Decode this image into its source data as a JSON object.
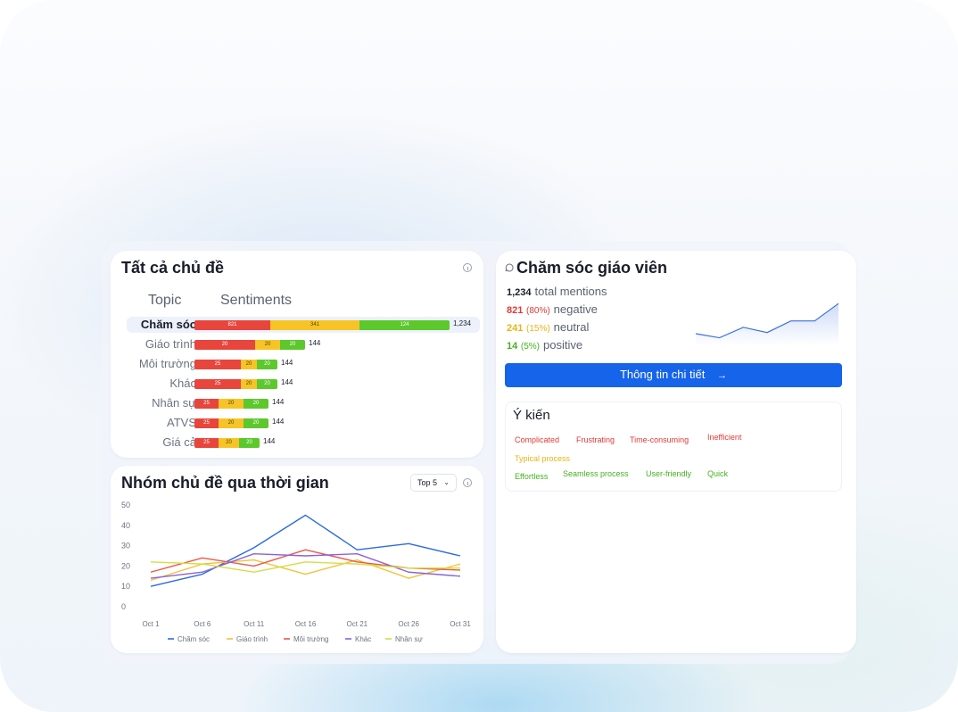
{
  "topics_card": {
    "title": "Tất cả chủ đề",
    "col_topic": "Topic",
    "col_sentiments": "Sentiments",
    "rows": [
      {
        "label": "Chăm sóc",
        "neg": "821",
        "neu": "341",
        "pos": "124",
        "total": "1,234"
      },
      {
        "label": "Giáo trình",
        "neg": "20",
        "neu": "20",
        "pos": "20",
        "total": "144"
      },
      {
        "label": "Môi trường",
        "neg": "25",
        "neu": "20",
        "pos": "20",
        "total": "144"
      },
      {
        "label": "Khác",
        "neg": "25",
        "neu": "20",
        "pos": "20",
        "total": "144"
      },
      {
        "label": "Nhân sự",
        "neg": "25",
        "neu": "20",
        "pos": "20",
        "total": "144"
      },
      {
        "label": "ATVS",
        "neg": "25",
        "neu": "20",
        "pos": "20",
        "total": "144"
      },
      {
        "label": "Giá cả",
        "neg": "25",
        "neu": "20",
        "pos": "20",
        "total": "144"
      }
    ],
    "colors": {
      "negative": "#e8453c",
      "neutral": "#f6c426",
      "positive": "#5cc82c"
    }
  },
  "trend_card": {
    "title": "Nhóm chủ đề qua thời gian",
    "dropdown_value": "Top 5"
  },
  "chart_data": {
    "type": "line",
    "x": [
      "Oct 1",
      "Oct 6",
      "Oct 11",
      "Oct 16",
      "Oct 21",
      "Oct 26",
      "Oct 31"
    ],
    "yticks": [
      "0",
      "10",
      "20",
      "30",
      "40",
      "50"
    ],
    "ylim": [
      0,
      50
    ],
    "grid": false,
    "legend_position": "bottom",
    "series": [
      {
        "name": "Chăm sóc",
        "color": "#2d6be0",
        "values": [
          10,
          16,
          29,
          45,
          28,
          31,
          25
        ]
      },
      {
        "name": "Giáo trình",
        "color": "#f2c33b",
        "values": [
          13,
          21,
          23,
          16,
          23,
          14,
          21
        ]
      },
      {
        "name": "Môi trường",
        "color": "#e85a4a",
        "values": [
          17,
          24,
          20,
          28,
          22,
          19,
          18
        ]
      },
      {
        "name": "Khác",
        "color": "#8a63d8",
        "values": [
          14,
          17,
          26,
          25,
          26,
          17,
          15
        ]
      },
      {
        "name": "Nhân sự",
        "color": "#d7dc44",
        "values": [
          22,
          21,
          17,
          22,
          21,
          19,
          19
        ]
      }
    ]
  },
  "detail_card": {
    "title": "Chăm sóc giáo viên",
    "total": {
      "num": "1,234",
      "label": "total mentions"
    },
    "negative": {
      "num": "821",
      "pct": "(80%)",
      "label": "negative"
    },
    "neutral": {
      "num": "241",
      "pct": "(15%)",
      "label": "neutral"
    },
    "positive": {
      "num": "14",
      "pct": "(5%)",
      "label": "positive"
    },
    "sparkline": [
      20,
      13,
      31,
      22,
      42,
      42,
      72
    ],
    "button_label": "Thông tin chi tiết",
    "opinions_title": "Ý kiến",
    "tags": {
      "negative": [
        "Complicated",
        "Frustrating",
        "Time-consuming",
        "Inefficient"
      ],
      "neutral": [
        "Typical process"
      ],
      "positive": [
        "Effortless",
        "Seamless process",
        "User-friendly",
        "Quick"
      ]
    },
    "colors": {
      "negative": "#e23a34",
      "neutral": "#e8b417",
      "positive": "#43b21e",
      "button": "#1664ea"
    }
  }
}
